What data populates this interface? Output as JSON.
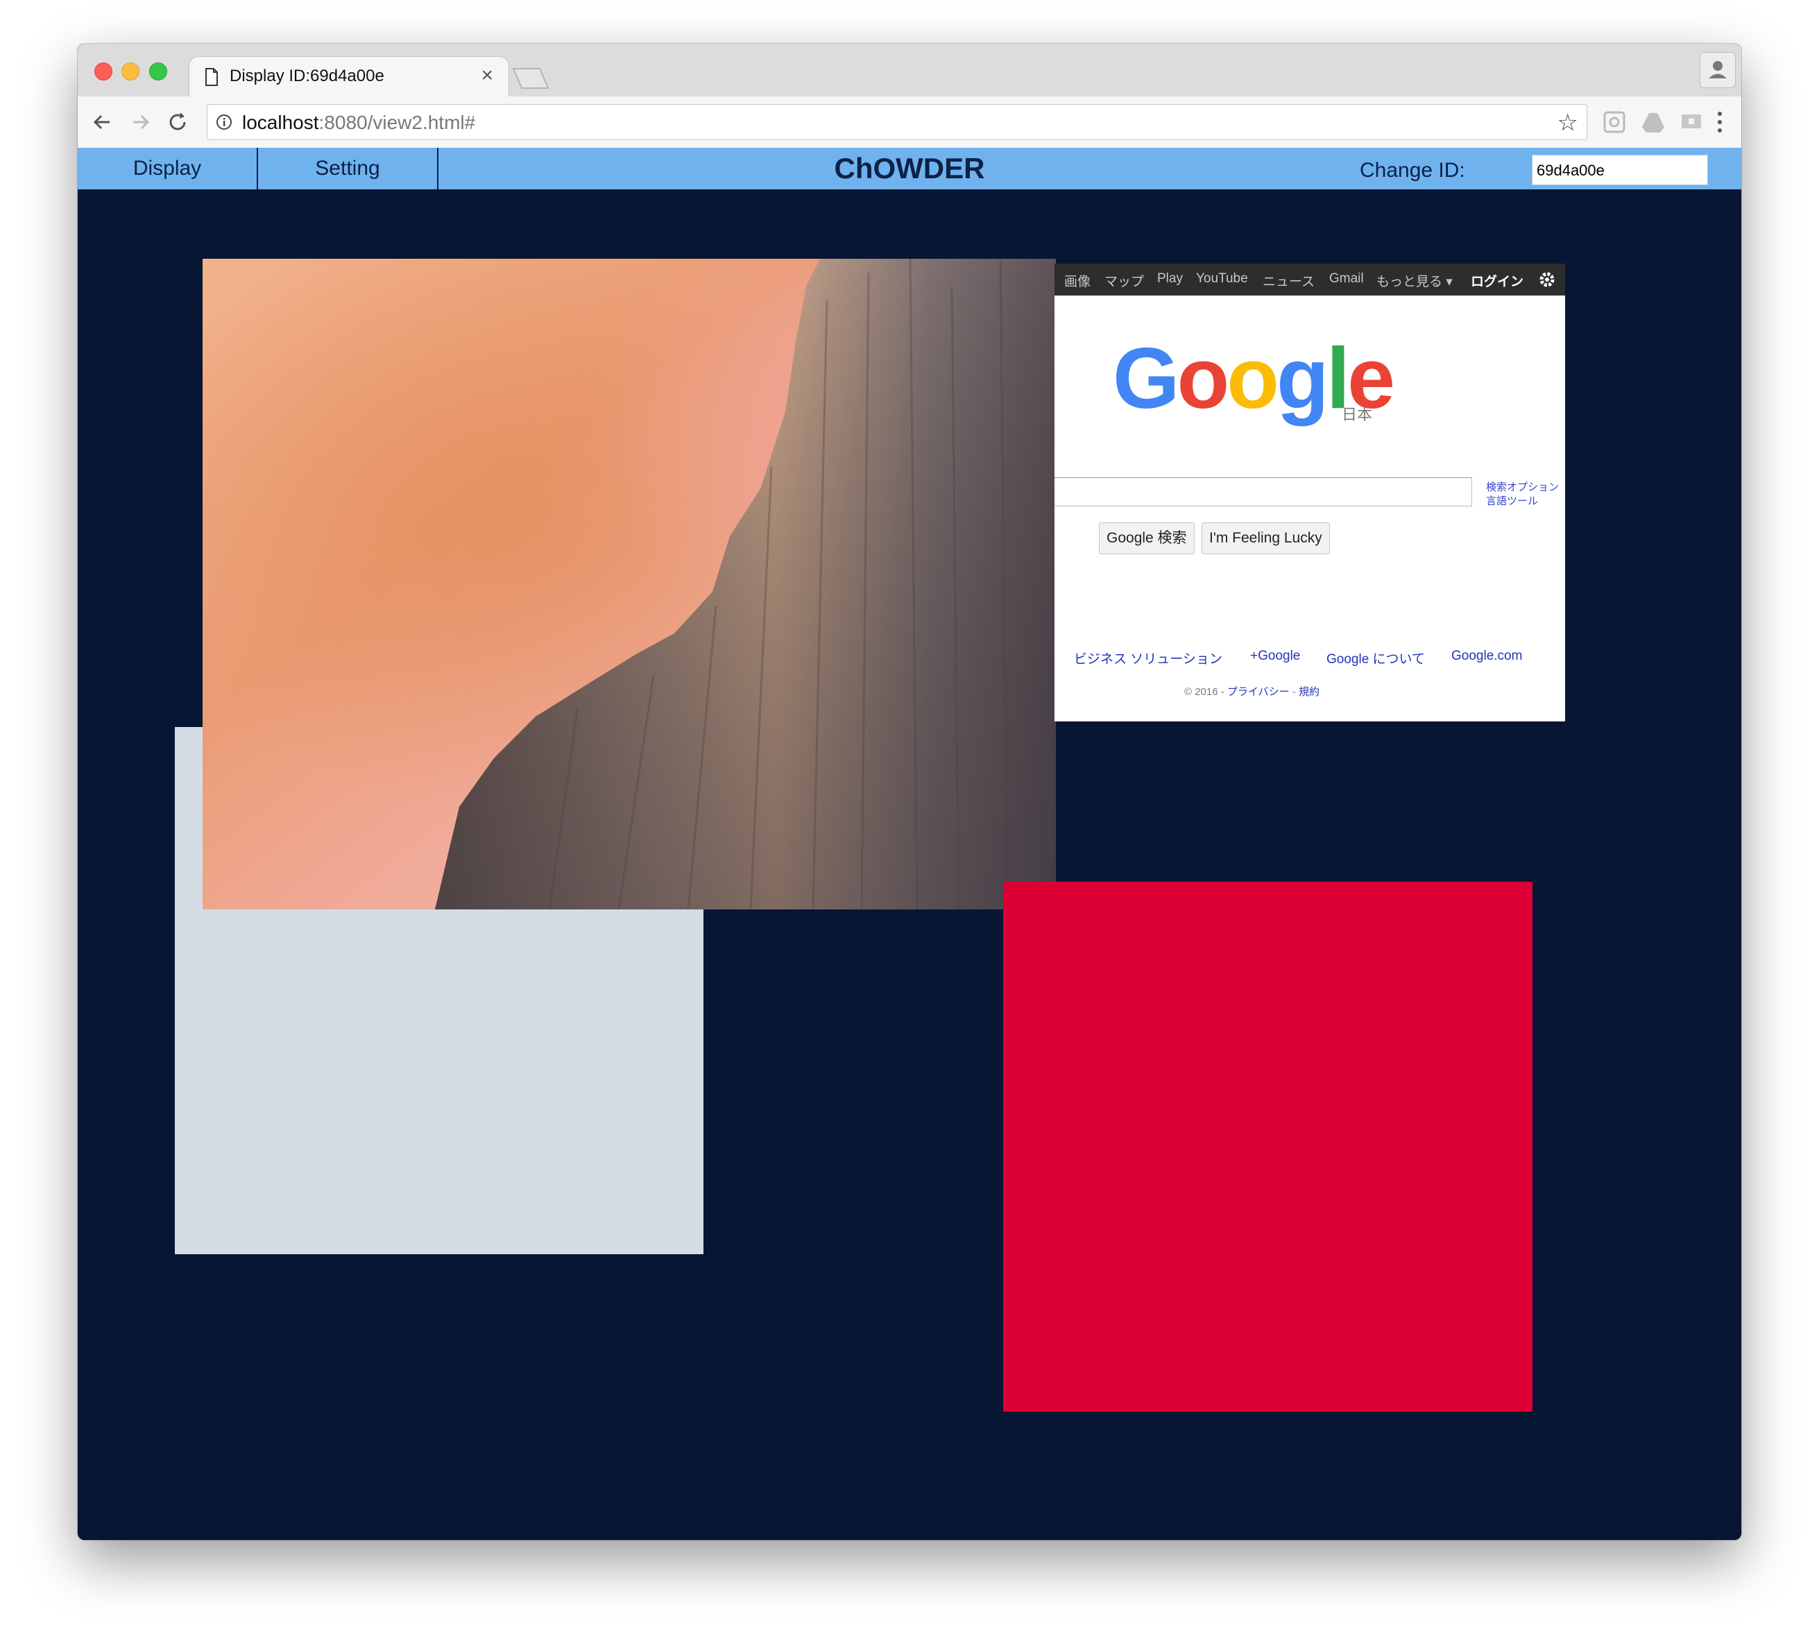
{
  "browser": {
    "tab_title": "Display ID:69d4a00e",
    "tab_close": "×",
    "url_host": "localhost",
    "url_rest": ":8080/view2.html#",
    "bookmark_star": "☆"
  },
  "app": {
    "tabs": [
      "Display",
      "Setting"
    ],
    "title": "ChOWDER",
    "change_id_label": "Change ID:",
    "id_value": "69d4a00e",
    "colors": {
      "header": "#6fb2ee",
      "canvas": "#071632",
      "gray_window": "#d4dce5",
      "red_window": "#dc0034"
    }
  },
  "google": {
    "nav": [
      "画像",
      "マップ",
      "Play",
      "YouTube",
      "ニュース",
      "Gmail",
      "もっと見る ▾"
    ],
    "login": "ログイン",
    "logo_region": "日本",
    "options": [
      "検索オプション",
      "言語ツール"
    ],
    "buttons": {
      "search": "Google 検索",
      "lucky": "I'm Feeling Lucky"
    },
    "footer": [
      "ビジネス ソリューション",
      "+Google",
      "Google について",
      "Google.com"
    ],
    "copyright_prefix": "© 2016 - ",
    "privacy": "プライバシー",
    "terms": "規約",
    "separator": " - "
  }
}
